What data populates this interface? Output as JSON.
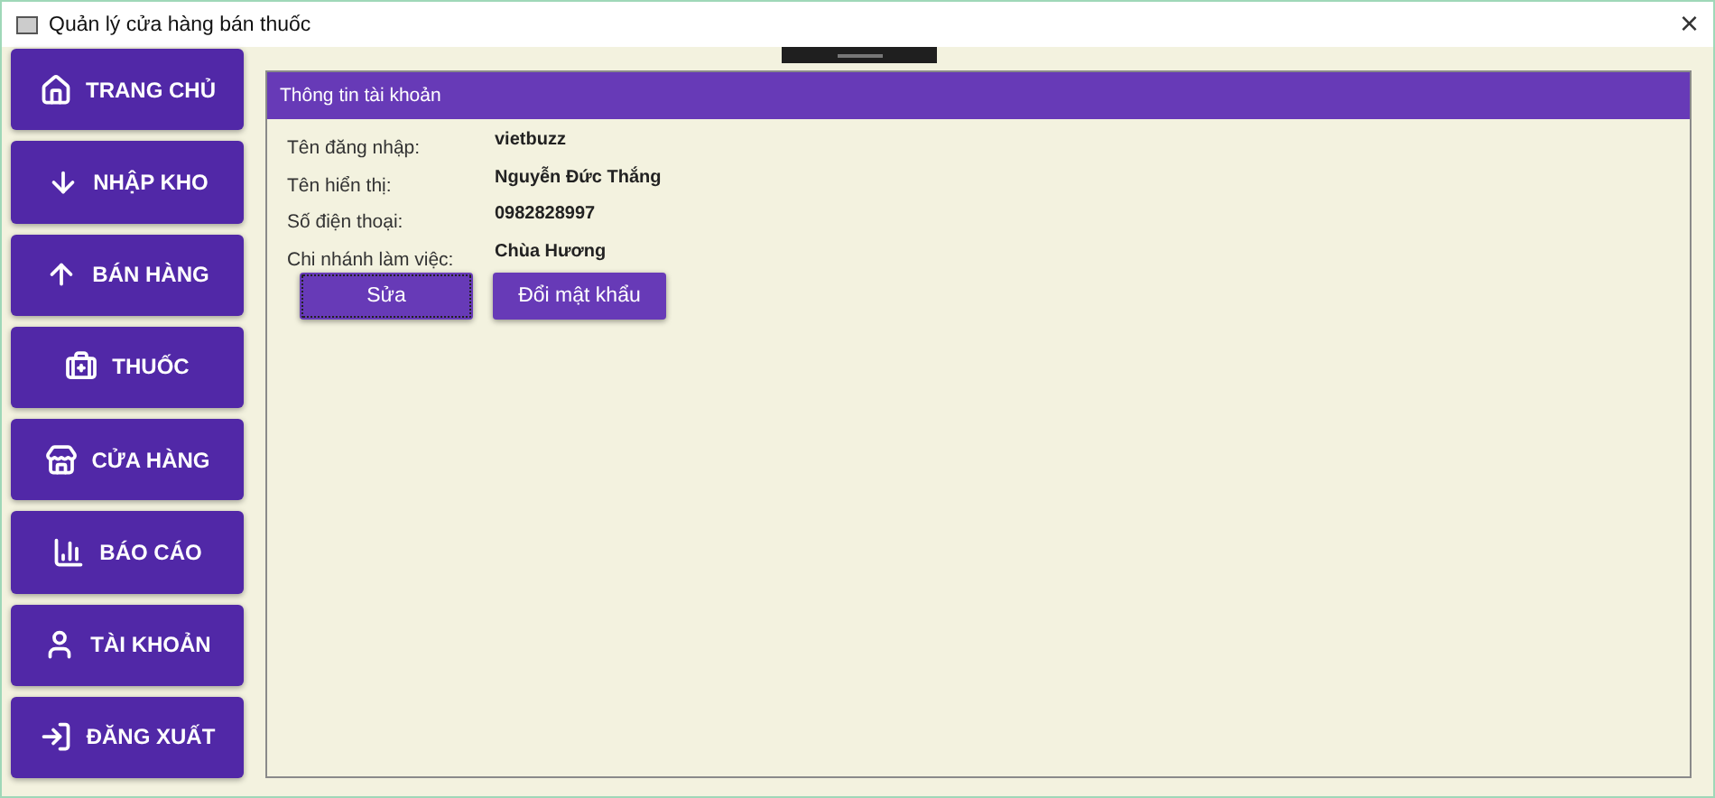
{
  "window": {
    "title": "Quản lý cửa hàng bán thuốc",
    "close": "×"
  },
  "sidebar": {
    "items": [
      {
        "label": "TRANG CHỦ"
      },
      {
        "label": "NHẬP KHO"
      },
      {
        "label": "BÁN HÀNG"
      },
      {
        "label": "THUỐC"
      },
      {
        "label": "CỬA HÀNG"
      },
      {
        "label": "BÁO CÁO"
      },
      {
        "label": "TÀI KHOẢN"
      },
      {
        "label": "ĐĂNG XUẤT"
      }
    ]
  },
  "panel": {
    "title": "Thông tin tài khoản",
    "fields": [
      {
        "label": "Tên đăng nhập:",
        "value": "vietbuzz"
      },
      {
        "label": "Tên hiển thị:",
        "value": "Nguyễn Đức Thắng"
      },
      {
        "label": "Số điện thoại:",
        "value": "0982828997"
      },
      {
        "label": "Chi nhánh làm việc:",
        "value": "Chùa Hương"
      }
    ],
    "buttons": [
      {
        "label": "Sửa",
        "focused": true
      },
      {
        "label": "Đổi mật khẩu",
        "focused": false
      }
    ]
  }
}
